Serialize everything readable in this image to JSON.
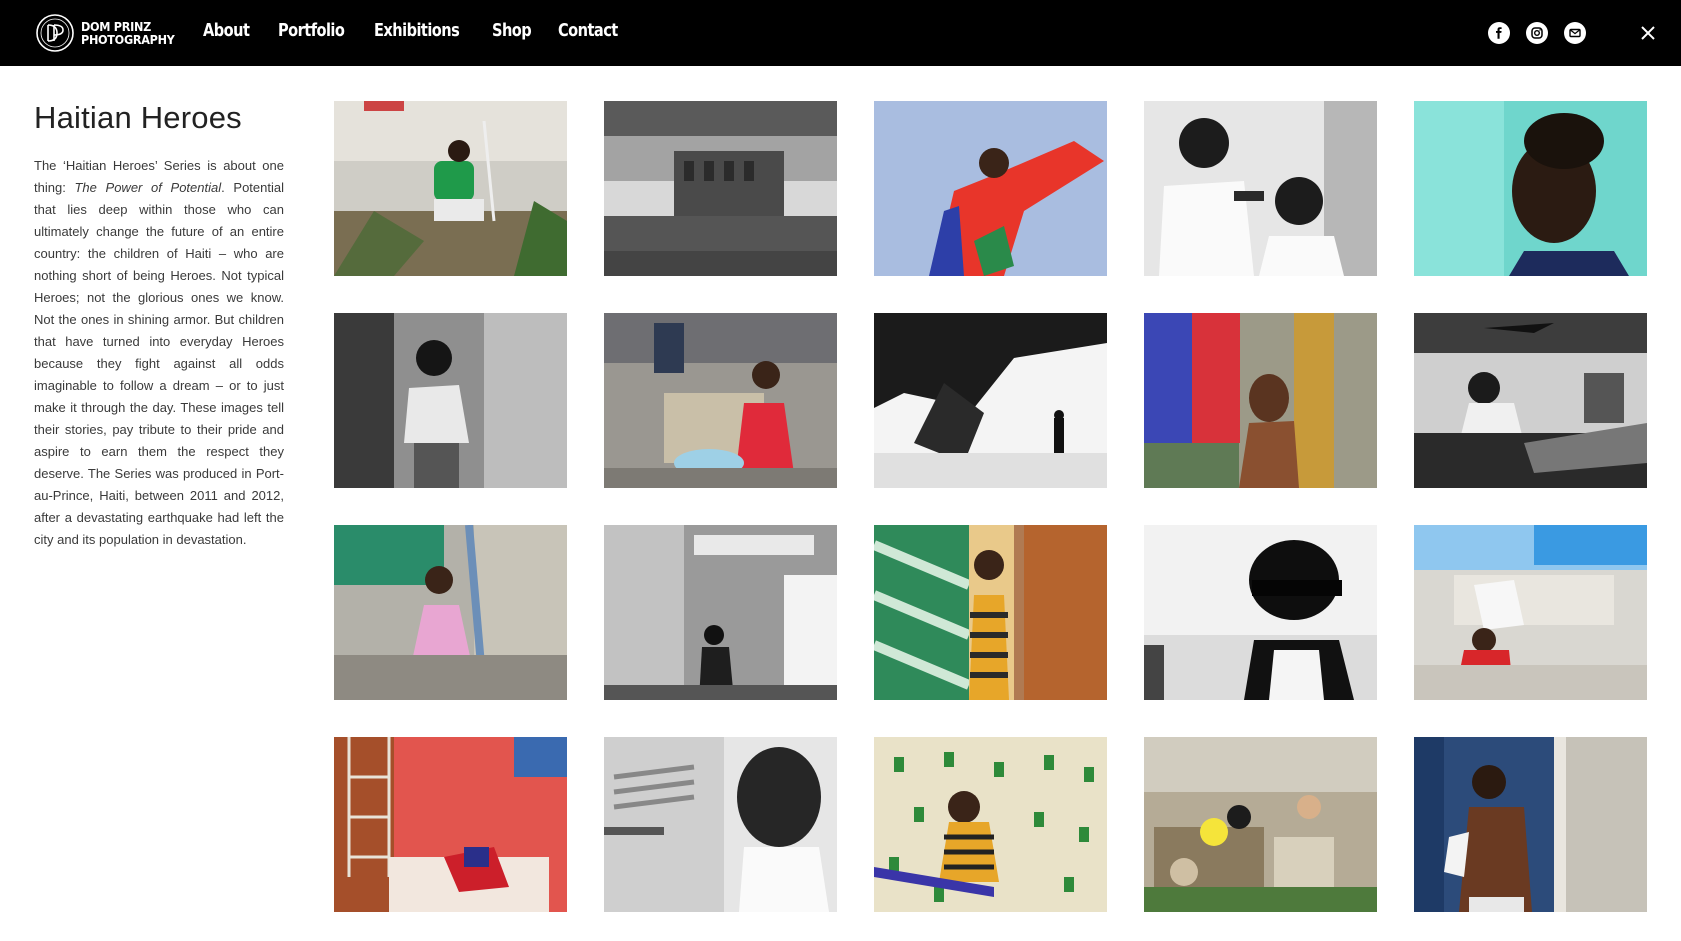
{
  "header": {
    "logo_text_line1": "DOM PRINZ",
    "logo_text_line2": "PHOTOGRAPHY",
    "logo_icon": "dp-monogram-icon",
    "nav": [
      {
        "label": "About"
      },
      {
        "label": "Portfolio"
      },
      {
        "label": "Exhibitions"
      },
      {
        "label": "Shop"
      },
      {
        "label": "Contact"
      }
    ],
    "social_icons": [
      "facebook-icon",
      "instagram-icon",
      "email-icon"
    ],
    "close_icon": "close-icon"
  },
  "project": {
    "title": "Haitian Heroes",
    "desc_1": "The ‘Haitian Heroes’ Series is about one thing: ",
    "desc_em": "The Power of Potential",
    "desc_2": ". Potential that lies deep within those who can ultimately change the future of an entire country: the children of Haiti – who are nothing short of being Heroes. Not typical Heroes; not the glorious ones we know. Not the ones in shining armor. But children that have turned into everyday Heroes because they fight against all odds imaginable to follow a dream – or to just make it through the day. These images tell their stories, pay tribute to their pride and aspire to earn them the respect they deserve. The Series was produced in Port-au-Prince, Haiti, between 2011 and 2012, after a devastating earthquake had left the city and its population in devastation."
  },
  "colors": {
    "header_bg": "#000000",
    "nav_text": "#ffffff",
    "page_bg": "#ffffff",
    "body_text": "#3a3a3a"
  }
}
